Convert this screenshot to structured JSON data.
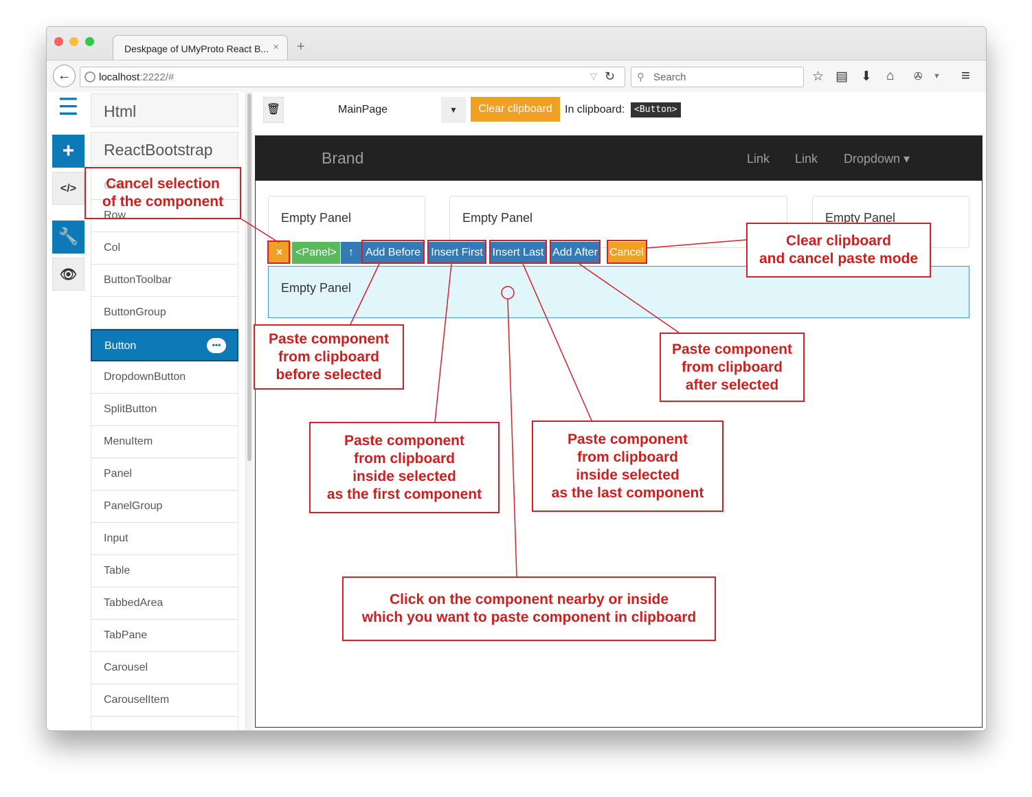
{
  "browser": {
    "tab_title": "Deskpage of UMyProto React B...",
    "tab_close": "×",
    "new_tab": "+",
    "url_host": "localhost",
    "url_rest": ":2222/#",
    "search_placeholder": "Search"
  },
  "sidebar": {
    "categories": [
      "Html",
      "ReactBootstrap"
    ],
    "partial_items": [
      "Grid",
      "Row"
    ],
    "items": [
      "Col",
      "ButtonToolbar",
      "ButtonGroup",
      "Button",
      "DropdownButton",
      "SplitButton",
      "MenuItem",
      "Panel",
      "PanelGroup",
      "Input",
      "Table",
      "TabbedArea",
      "TabPane",
      "Carousel",
      "CarouselItem"
    ],
    "active_item": "Button",
    "active_more": "•••"
  },
  "toolbar": {
    "page_name": "MainPage",
    "clear_clipboard": "Clear clipboard",
    "in_clipboard_label": "In clipboard:",
    "clipboard_value": "<Button>"
  },
  "navbar": {
    "brand": "Brand",
    "links": [
      "Link",
      "Link"
    ],
    "dropdown": "Dropdown ▾"
  },
  "panels": [
    "Empty Panel",
    "Empty Panel",
    "Empty Panel",
    "Empty Panel"
  ],
  "paste_toolbar": {
    "close": "×",
    "component": "<Panel>",
    "parent": "↑",
    "add_before": "Add Before",
    "insert_first": "Insert First",
    "insert_last": "Insert Last",
    "add_after": "Add After",
    "cancel": "Cancel"
  },
  "callouts": {
    "cancel_selection": [
      "Cancel selection",
      "of the component"
    ],
    "clear_clipboard": [
      "Clear clipboard",
      "and cancel paste mode"
    ],
    "before": [
      "Paste component",
      "from clipboard",
      "before selected"
    ],
    "after": [
      "Paste component",
      "from clipboard",
      "after selected"
    ],
    "first": [
      "Paste component",
      "from clipboard",
      "inside selected",
      "as the first component"
    ],
    "last": [
      "Paste component",
      "from clipboard",
      "inside selected",
      "as the last component"
    ],
    "click": [
      "Click on the component nearby or inside",
      "which you want to paste component in clipboard"
    ]
  },
  "colors": {
    "primary": "#0d7ab7",
    "warning": "#f0a022",
    "success": "#5cb85c",
    "button_blue": "#337ab7",
    "annotation": "#cc1f1f",
    "navbar": "#222222"
  }
}
